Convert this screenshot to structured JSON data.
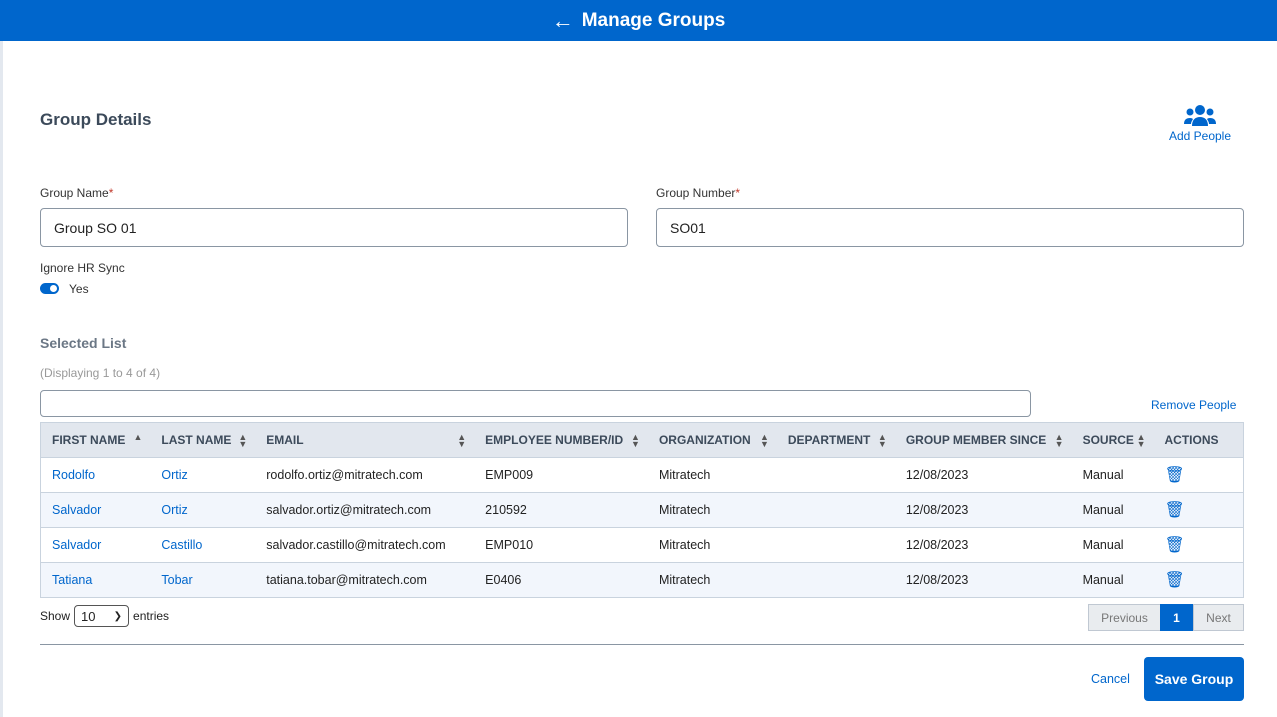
{
  "header": {
    "title": "Manage Groups",
    "back_icon": "arrow-left-icon"
  },
  "section_title": "Group Details",
  "add_people": {
    "label": "Add People",
    "icon": "users-icon"
  },
  "form": {
    "group_name_label": "Group Name",
    "group_name_value": "Group SO 01",
    "group_number_label": "Group Number",
    "group_number_value": "SO01",
    "required_mark": "*",
    "ignore_hr_label": "Ignore HR Sync",
    "ignore_hr_value": "Yes",
    "ignore_hr_on": true
  },
  "selected_list": {
    "title": "Selected List",
    "displaying": "(Displaying 1 to 4 of 4)",
    "search_value": "",
    "remove_people": "Remove People"
  },
  "table": {
    "columns": [
      "FIRST NAME",
      "LAST NAME",
      "EMAIL",
      "EMPLOYEE NUMBER/ID",
      "ORGANIZATION",
      "DEPARTMENT",
      "GROUP MEMBER SINCE",
      "SOURCE",
      "ACTIONS"
    ],
    "rows": [
      [
        "Rodolfo",
        "Ortiz",
        "rodolfo.ortiz@mitratech.com",
        "EMP009",
        "Mitratech",
        "",
        "12/08/2023",
        "Manual"
      ],
      [
        "Salvador",
        "Ortiz",
        "salvador.ortiz@mitratech.com",
        "210592",
        "Mitratech",
        "",
        "12/08/2023",
        "Manual"
      ],
      [
        "Salvador",
        "Castillo",
        "salvador.castillo@mitratech.com",
        "EMP010",
        "Mitratech",
        "",
        "12/08/2023",
        "Manual"
      ],
      [
        "Tatiana",
        "Tobar",
        "tatiana.tobar@mitratech.com",
        "E0406",
        "Mitratech",
        "",
        "12/08/2023",
        "Manual"
      ]
    ]
  },
  "paging": {
    "show": "Show",
    "entries": "entries",
    "page_size": "10",
    "previous": "Previous",
    "current": "1",
    "next": "Next"
  },
  "footer": {
    "cancel": "Cancel",
    "save": "Save Group"
  },
  "colors": {
    "brand": "#0066cc"
  }
}
